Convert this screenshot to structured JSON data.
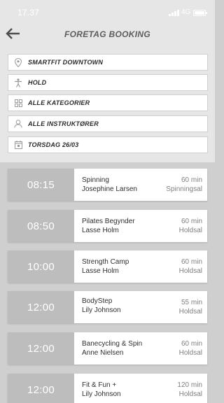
{
  "status_bar": {
    "time": "17.37",
    "network": "4G"
  },
  "header": {
    "title": "FORETAG BOOKING",
    "back_icon": "arrow-left-icon"
  },
  "filters": [
    {
      "icon": "location-pin-icon",
      "label": "SMARTFIT DOWNTOWN"
    },
    {
      "icon": "person-icon",
      "label": "HOLD"
    },
    {
      "icon": "grid-icon",
      "label": "ALLE KATEGORIER"
    },
    {
      "icon": "user-icon",
      "label": "ALLE INSTRUKTØRER"
    },
    {
      "icon": "calendar-icon",
      "label": "TORSDAG 26/03"
    }
  ],
  "classes": [
    {
      "time": "08:15",
      "name": "Spinning",
      "instructor": "Josephine Larsen",
      "duration": "60 min",
      "room": "Spinningsal"
    },
    {
      "time": "08:50",
      "name": "Pilates Begynder",
      "instructor": "Lasse Holm",
      "duration": "60 min",
      "room": "Holdsal"
    },
    {
      "time": "10:00",
      "name": "Strength Camp",
      "instructor": "Lasse Holm",
      "duration": "60 min",
      "room": "Holdsal"
    },
    {
      "time": "12:00",
      "name": "BodyStep",
      "instructor": "Lily Johnson",
      "duration": "55 min",
      "room": "Holdsal"
    },
    {
      "time": "12:00",
      "name": "Banecycling & Spin",
      "instructor": "Anne Nielsen",
      "duration": "60 min",
      "room": "Holdsal"
    },
    {
      "time": "12:00",
      "name": "Fit & Fun +",
      "instructor": "Lily Johnson",
      "duration": "120 min",
      "room": "Holdsal"
    }
  ],
  "colors": {
    "header_bg": "#e6e6e6",
    "list_bg": "#cfcfcf",
    "time_block": "#bdbdbd",
    "card_bg": "#ffffff"
  }
}
